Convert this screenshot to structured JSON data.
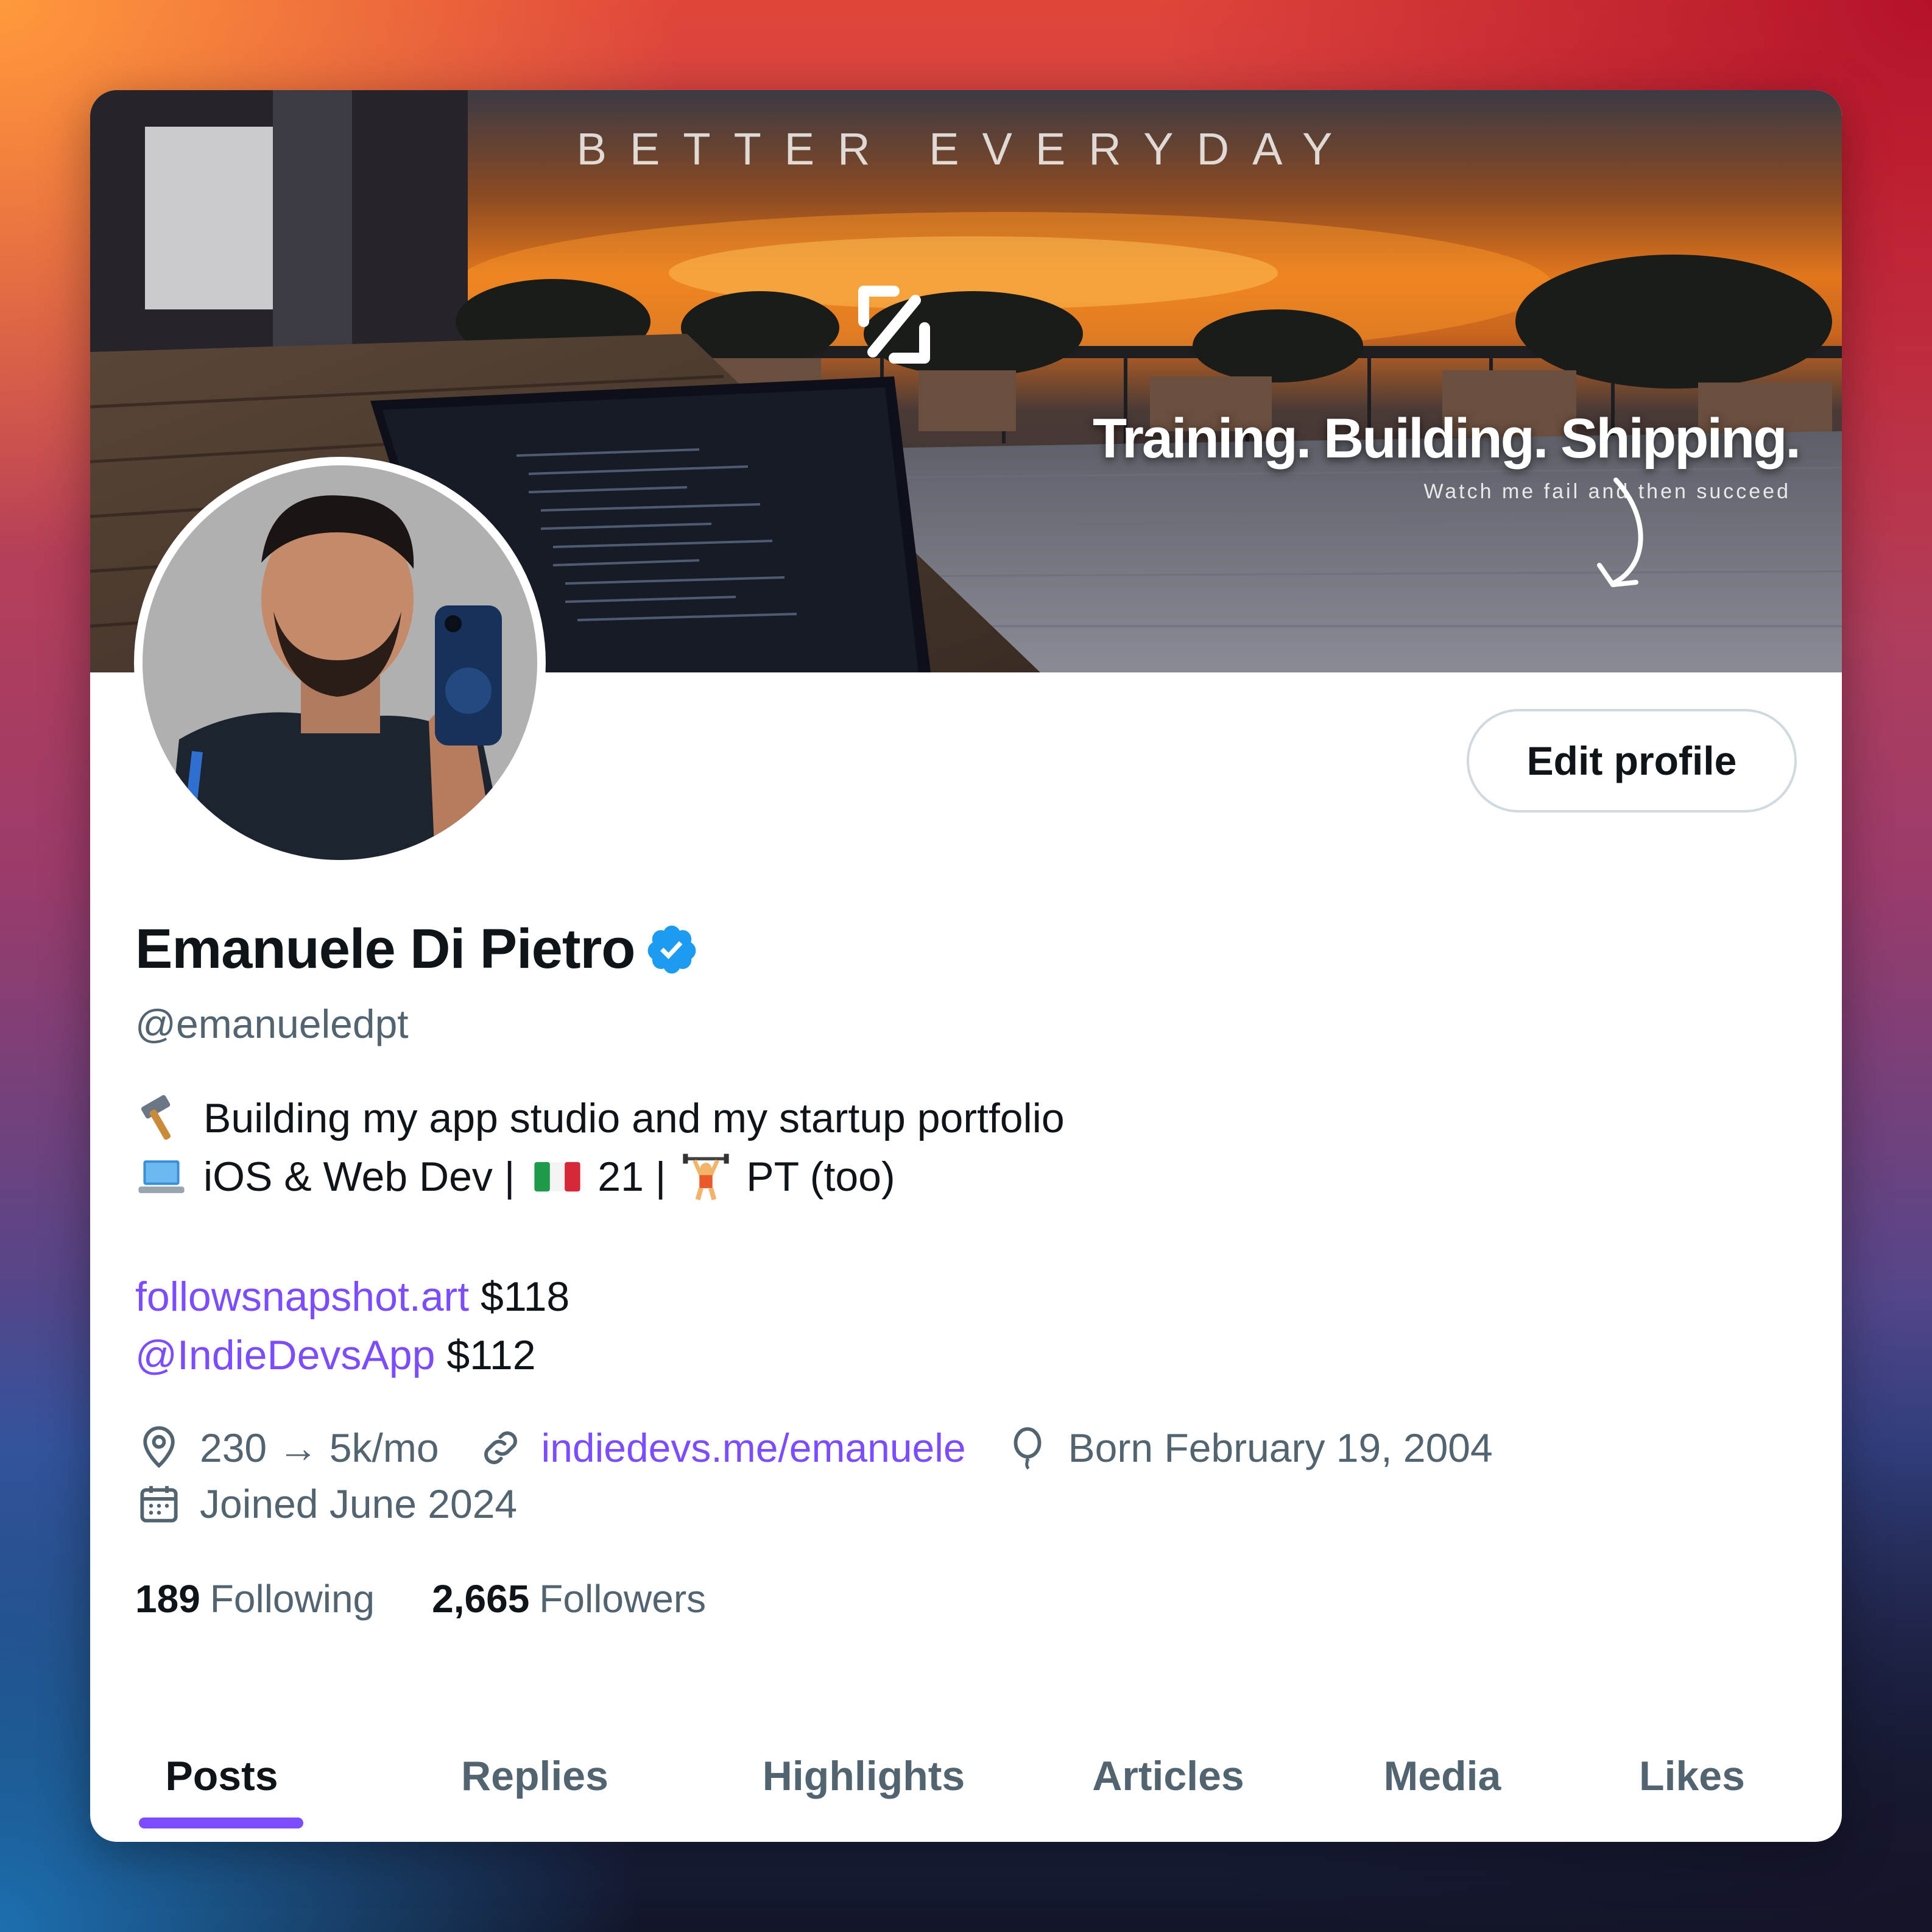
{
  "banner": {
    "top_text": "BETTER EVERYDAY",
    "headline": "Training. Building. Shipping.",
    "subline": "Watch me fail and then succeed"
  },
  "profile": {
    "name": "Emanuele Di Pietro",
    "verified": true,
    "handle": "@emanueledpt",
    "edit_button": "Edit profile",
    "bio": {
      "line1": "Building my app studio and my startup portfolio",
      "line1_emoji": "hammer-emoji",
      "line2_a": "iOS & Web Dev | ",
      "line2_b": " 21 | ",
      "line2_c": " PT (too)",
      "line2_emojis": [
        "laptop-emoji",
        "italy-flag-emoji",
        "weightlifter-emoji"
      ]
    },
    "projects": [
      {
        "name": "followsnapshot.art",
        "revenue": "$118"
      },
      {
        "name": "@IndieDevsApp",
        "revenue": "$112"
      }
    ],
    "meta": {
      "location": "230 → 5k/mo",
      "website": "indiedevs.me/emanuele",
      "birthday": "Born February 19, 2004",
      "joined": "Joined June 2024"
    },
    "stats": {
      "following_count": "189",
      "following_label": "Following",
      "followers_count": "2,665",
      "followers_label": "Followers"
    }
  },
  "tabs": [
    "Posts",
    "Replies",
    "Highlights",
    "Articles",
    "Media",
    "Likes"
  ],
  "active_tab": "Posts",
  "colors": {
    "accent": "#7c4dff",
    "verified": "#1d9bf0",
    "text_primary": "#0f1419",
    "text_secondary": "#536471"
  }
}
